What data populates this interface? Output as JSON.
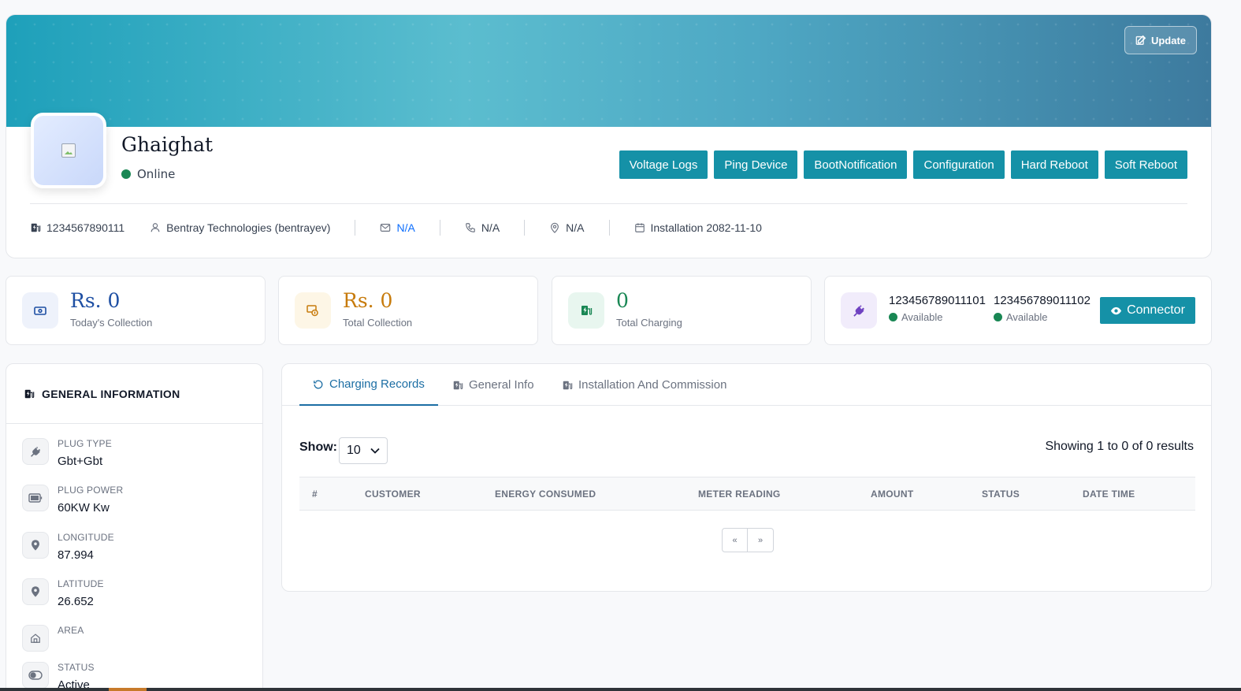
{
  "header": {
    "update_label": "Update",
    "station_name": "Ghaighat",
    "status": "Online",
    "actions": [
      "Voltage Logs",
      "Ping Device",
      "BootNotification",
      "Configuration",
      "Hard Reboot",
      "Soft Reboot"
    ]
  },
  "meta": {
    "station_id": "1234567890111",
    "owner": "Bentray Technologies (bentrayev)",
    "email": "N/A",
    "phone": "N/A",
    "location": "N/A",
    "installation": "Installation 2082-11-10"
  },
  "stats": {
    "today": {
      "value": "Rs. 0",
      "label": "Today's Collection",
      "color": "#1e4fa3"
    },
    "total": {
      "value": "Rs. 0",
      "label": "Total Collection",
      "color": "#c77b0c"
    },
    "charging": {
      "value": "0",
      "label": "Total Charging",
      "color": "#198754"
    }
  },
  "connectors": {
    "items": [
      {
        "id": "123456789011101",
        "status": "Available"
      },
      {
        "id": "123456789011102",
        "status": "Available"
      }
    ],
    "button_label": "Connector"
  },
  "general_info": {
    "title": "GENERAL INFORMATION",
    "fields": [
      {
        "label": "PLUG TYPE",
        "value": "Gbt+Gbt",
        "icon": "plug-icon"
      },
      {
        "label": "PLUG POWER",
        "value": "60KW Kw",
        "icon": "battery-icon"
      },
      {
        "label": "LONGITUDE",
        "value": "87.994",
        "icon": "pin-icon"
      },
      {
        "label": "LATITUDE",
        "value": "26.652",
        "icon": "pin-icon"
      },
      {
        "label": "AREA",
        "value": "",
        "icon": "home-icon"
      },
      {
        "label": "STATUS",
        "value": "Active",
        "icon": "toggle-icon"
      }
    ]
  },
  "records": {
    "tabs": [
      "Charging Records",
      "General Info",
      "Installation And Commission"
    ],
    "show_label": "Show:",
    "page_size": "10",
    "results_text": "Showing 1 to 0 of 0 results",
    "columns": [
      "#",
      "CUSTOMER",
      "ENERGY CONSUMED",
      "METER READING",
      "AMOUNT",
      "STATUS",
      "DATE TIME"
    ],
    "prev_label": "«",
    "next_label": "»"
  },
  "colors": {
    "accent": "#1591a7",
    "online": "#198754",
    "link": "#0d6efd",
    "tab_active": "#1c6ea4"
  }
}
